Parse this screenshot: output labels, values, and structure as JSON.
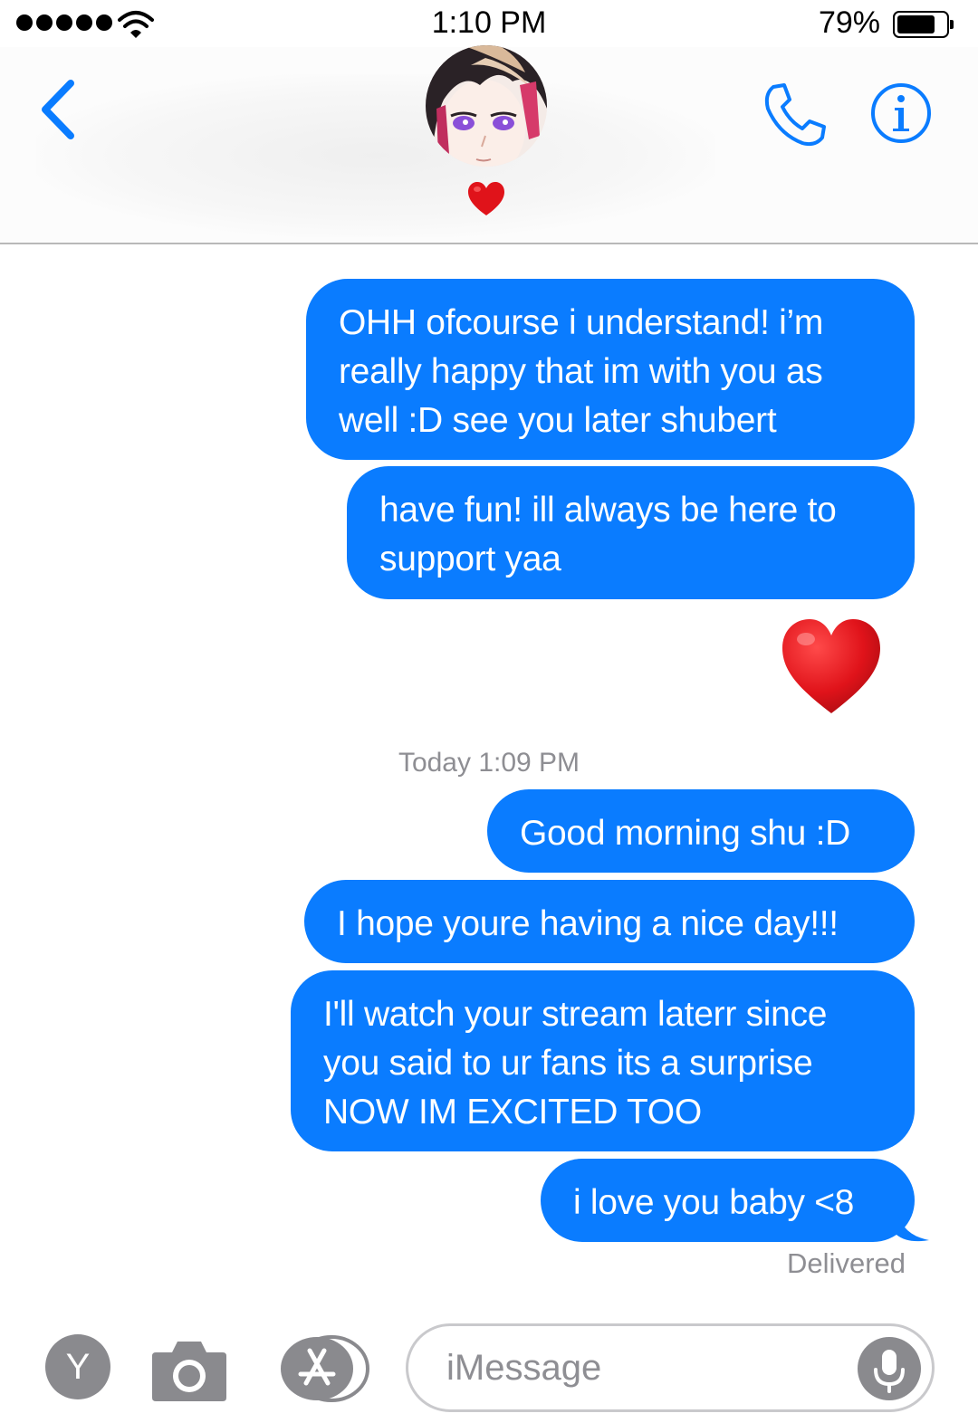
{
  "status_bar": {
    "time": "1:10 PM",
    "battery_percent_label": "79%",
    "battery_level": 0.79,
    "signal_bars": 5
  },
  "header": {
    "back_icon": "chevron-left-icon",
    "contact_avatar": "anime-character-avatar",
    "status_emoji": "red-heart",
    "call_icon": "phone-icon",
    "info_icon": "info-icon"
  },
  "messages": [
    {
      "text": "OHH ofcourse i understand! i’m\nreally happy that im with you as\nwell :D see you later shubert"
    },
    {
      "text": "have fun! ill always be here to\nsupport yaa"
    },
    {
      "emoji": "red-heart"
    },
    {
      "text": "Good morning shu :D"
    },
    {
      "text": "I hope youre having a nice day!!!"
    },
    {
      "text": "I'll watch your stream laterr since\nyou said to ur fans its a surprise\nNOW IM EXCITED TOO"
    },
    {
      "text": "i love you baby <8"
    }
  ],
  "timestamp": "Today 1:09 PM",
  "delivery_status": "Delivered",
  "input_bar": {
    "user_initial": "Y",
    "placeholder": "iMessage",
    "camera_icon": "camera-icon",
    "apps_icon": "app-store-icon",
    "mic_icon": "microphone-icon"
  },
  "colors": {
    "bubble": "#0a7cff",
    "accent": "#0a7cff",
    "meta_text": "#8e8e93"
  }
}
